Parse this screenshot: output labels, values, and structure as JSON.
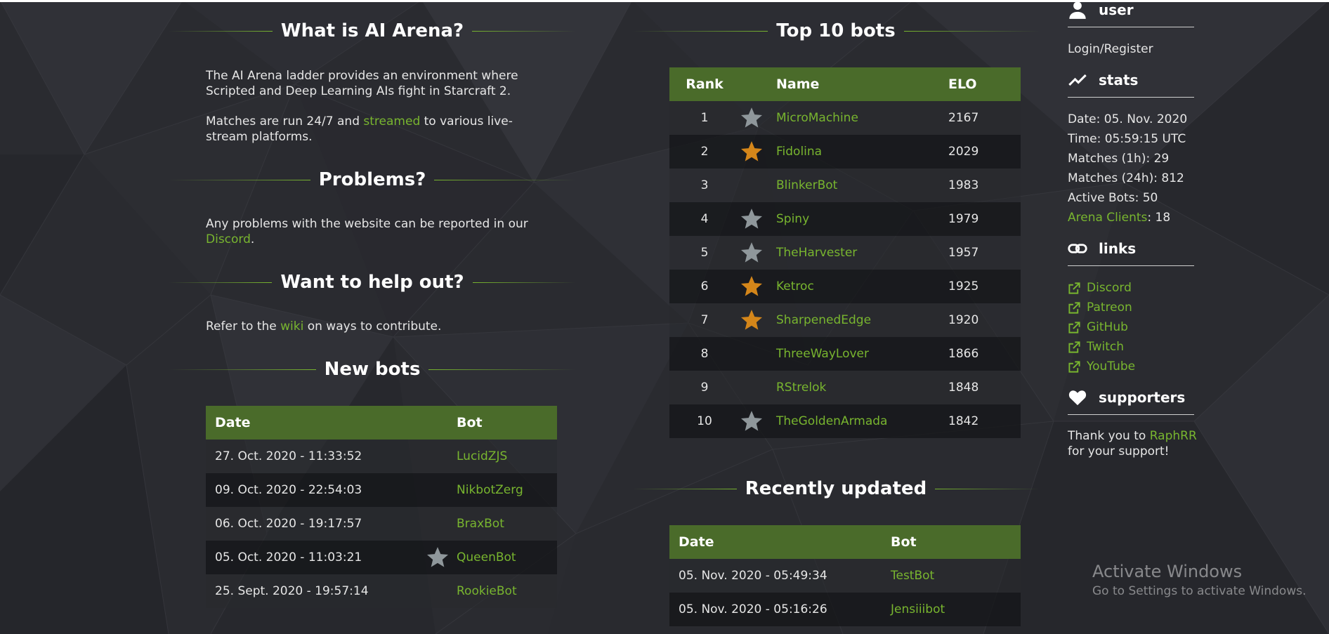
{
  "about": {
    "heading": "What is AI Arena?",
    "para1": "The AI Arena ladder provides an environment where Scripted and Deep Learning AIs fight in Starcraft 2.",
    "para2_pre": "Matches are run 24/7 and ",
    "para2_link": "streamed",
    "para2_post": " to various live-stream platforms."
  },
  "problems": {
    "heading": "Problems?",
    "text_pre": "Any problems with the website can be reported in our ",
    "text_link": "Discord",
    "text_post": "."
  },
  "help": {
    "heading": "Want to help out?",
    "text_pre": "Refer to the ",
    "text_link": "wiki",
    "text_post": " on ways to contribute."
  },
  "new_bots": {
    "heading": "New bots",
    "columns": [
      "Date",
      "Bot"
    ],
    "rows": [
      {
        "date": "27. Oct. 2020 - 11:33:52",
        "bot": "LucidZJS",
        "star": ""
      },
      {
        "date": "09. Oct. 2020 - 22:54:03",
        "bot": "NikbotZerg",
        "star": ""
      },
      {
        "date": "06. Oct. 2020 - 19:17:57",
        "bot": "BraxBot",
        "star": ""
      },
      {
        "date": "05. Oct. 2020 - 11:03:21",
        "bot": "QueenBot",
        "star": "silver"
      },
      {
        "date": "25. Sept. 2020 - 19:57:14",
        "bot": "RookieBot",
        "star": ""
      }
    ]
  },
  "top_bots": {
    "heading": "Top 10 bots",
    "columns": [
      "Rank",
      "Name",
      "ELO"
    ],
    "rows": [
      {
        "rank": "1",
        "name": "MicroMachine",
        "elo": "2167",
        "star": "silver"
      },
      {
        "rank": "2",
        "name": "Fidolina",
        "elo": "2029",
        "star": "gold"
      },
      {
        "rank": "3",
        "name": "BlinkerBot",
        "elo": "1983",
        "star": ""
      },
      {
        "rank": "4",
        "name": "Spiny",
        "elo": "1979",
        "star": "silver"
      },
      {
        "rank": "5",
        "name": "TheHarvester",
        "elo": "1957",
        "star": "silver"
      },
      {
        "rank": "6",
        "name": "Ketroc",
        "elo": "1925",
        "star": "gold"
      },
      {
        "rank": "7",
        "name": "SharpenedEdge",
        "elo": "1920",
        "star": "gold"
      },
      {
        "rank": "8",
        "name": "ThreeWayLover",
        "elo": "1866",
        "star": ""
      },
      {
        "rank": "9",
        "name": "RStrelok",
        "elo": "1848",
        "star": ""
      },
      {
        "rank": "10",
        "name": "TheGoldenArmada",
        "elo": "1842",
        "star": "silver"
      }
    ]
  },
  "recent": {
    "heading": "Recently updated",
    "columns": [
      "Date",
      "Bot"
    ],
    "rows": [
      {
        "date": "05. Nov. 2020 - 05:49:34",
        "bot": "TestBot"
      },
      {
        "date": "05. Nov. 2020 - 05:16:26",
        "bot": "Jensiiibot"
      }
    ]
  },
  "sidebar": {
    "user_heading": "user",
    "user_icon": "person-icon",
    "login_link": "Login/Register",
    "stats_heading": "stats",
    "stats_icon": "trending-icon",
    "stats": {
      "date": "Date: 05. Nov. 2020",
      "time": "Time: 05:59:15 UTC",
      "matches_1h": "Matches (1h): 29",
      "matches_24h": "Matches (24h): 812",
      "active_bots": "Active Bots: 50",
      "arena_clients_link": "Arena Clients",
      "arena_clients_value": ": 18"
    },
    "links_heading": "links",
    "links_icon": "link-icon",
    "links": [
      "Discord",
      "Patreon",
      "GitHub",
      "Twitch",
      "YouTube"
    ],
    "supporters_heading": "supporters",
    "supporters_icon": "heart-icon",
    "supporters_pre": "Thank you to ",
    "supporters_link": "RaphRR",
    "supporters_post": "for your support!"
  },
  "watermark": {
    "line1": "Activate Windows",
    "line2": "Go to Settings to activate Windows."
  },
  "colors": {
    "accent": "#78b52f",
    "header_bg": "#4a6b2a",
    "star_gold": "#d4861a",
    "star_silver": "#8f979b"
  }
}
